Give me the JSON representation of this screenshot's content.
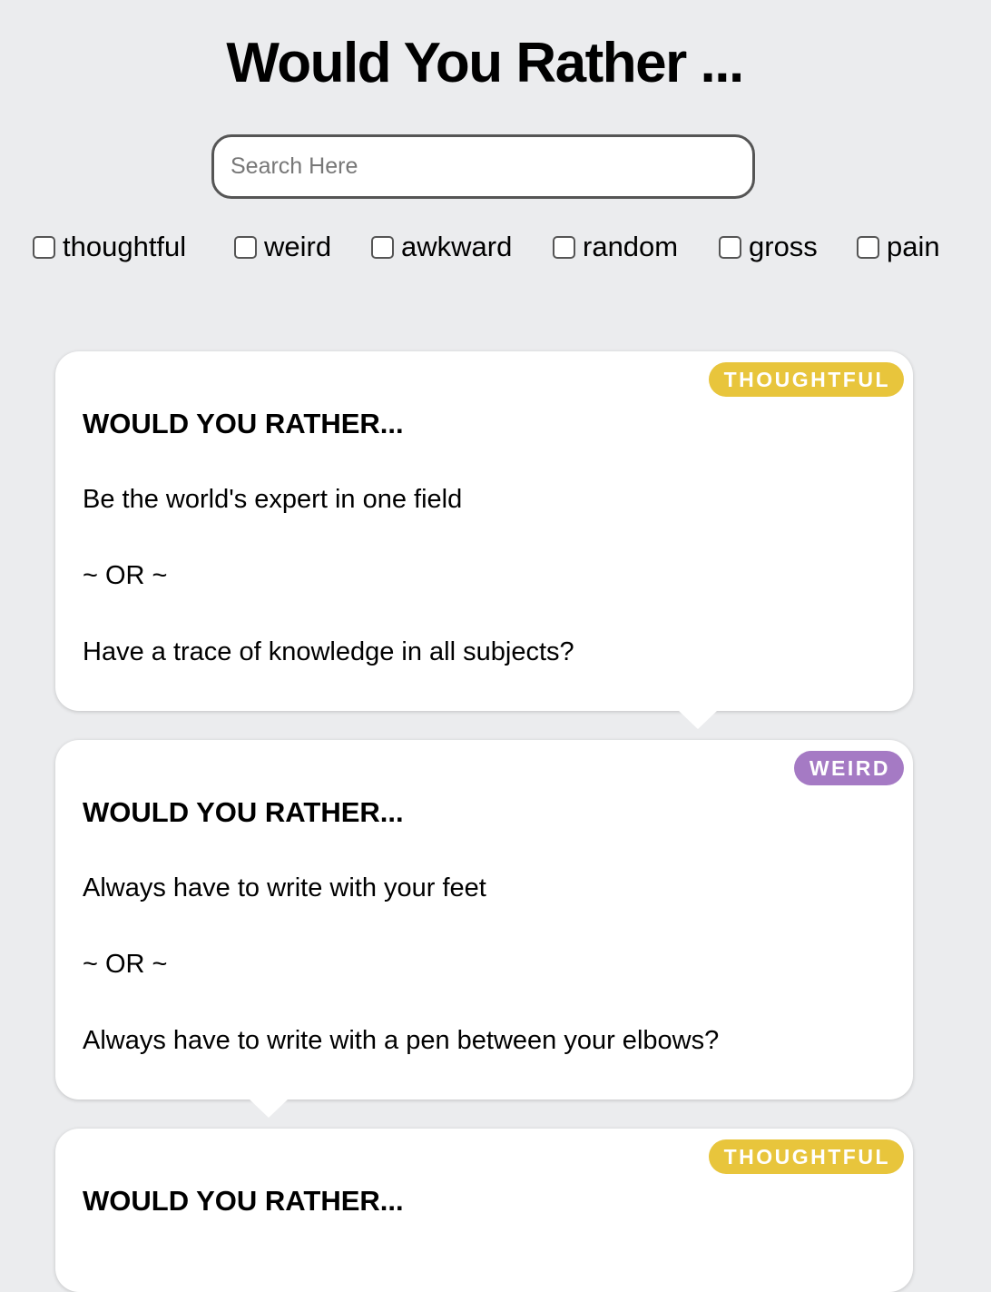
{
  "header": {
    "title": "Would You Rather ..."
  },
  "search": {
    "placeholder": "Search Here",
    "value": ""
  },
  "filters": [
    {
      "label": "thoughtful",
      "checked": false
    },
    {
      "label": "weird",
      "checked": false
    },
    {
      "label": "awkward",
      "checked": false
    },
    {
      "label": "random",
      "checked": false
    },
    {
      "label": "gross",
      "checked": false
    },
    {
      "label": "pain",
      "checked": false
    }
  ],
  "cards": [
    {
      "tag": "THOUGHTFUL",
      "tag_color": "#e8c53c",
      "heading": "WOULD YOU RATHER...",
      "option_a": "Be the world's expert in one field",
      "separator": "~ OR ~",
      "option_b": "Have a trace of knowledge in all subjects?"
    },
    {
      "tag": "WEIRD",
      "tag_color": "#a57ac4",
      "heading": "WOULD YOU RATHER...",
      "option_a": "Always have to write with your feet",
      "separator": "~ OR ~",
      "option_b": "Always have to write with a pen between your elbows?"
    },
    {
      "tag": "THOUGHTFUL",
      "tag_color": "#e8c53c",
      "heading": "WOULD YOU RATHER..."
    }
  ],
  "colors": {
    "background": "#ebecee",
    "card": "#ffffff",
    "thoughtful": "#e8c53c",
    "weird": "#a57ac4"
  }
}
